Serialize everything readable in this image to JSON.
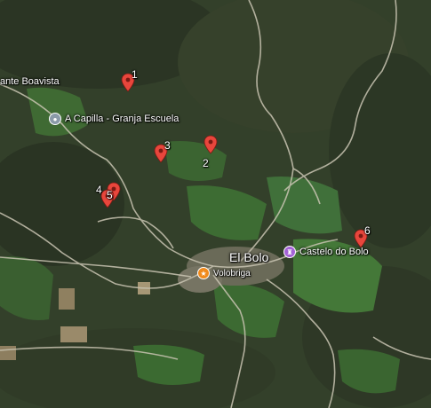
{
  "map": {
    "view": "satellite",
    "terrain_colors": {
      "forest_dark": "#2f3a26",
      "forest_mid": "#3f4d30",
      "field_green": "#3d6b32",
      "road": "#c9c4b2",
      "bare_soil": "#9a8a6a"
    }
  },
  "markers": [
    {
      "label": "1",
      "color": "#e8463c"
    },
    {
      "label": "2",
      "color": "#e8463c"
    },
    {
      "label": "3",
      "color": "#e8463c"
    },
    {
      "label": "4",
      "color": "#e8463c"
    },
    {
      "label": "5",
      "color": "#e8463c"
    },
    {
      "label": "6",
      "color": "#e8463c"
    }
  ],
  "places": {
    "boavista": {
      "name": "ante Boavista"
    },
    "capilla": {
      "name": "A Capilla -  Granja Escuela",
      "icon": "map-pin-poi-icon",
      "icon_color": "#8a9aa8"
    },
    "el_bolo": {
      "name": "El Bolo"
    },
    "castelo": {
      "name": "Castelo do Bolo",
      "icon": "castle-poi-icon",
      "icon_color": "#a463d6"
    },
    "volobriga": {
      "name": "Volobriga",
      "icon": "museum-poi-icon",
      "icon_color": "#f08a1c"
    }
  }
}
